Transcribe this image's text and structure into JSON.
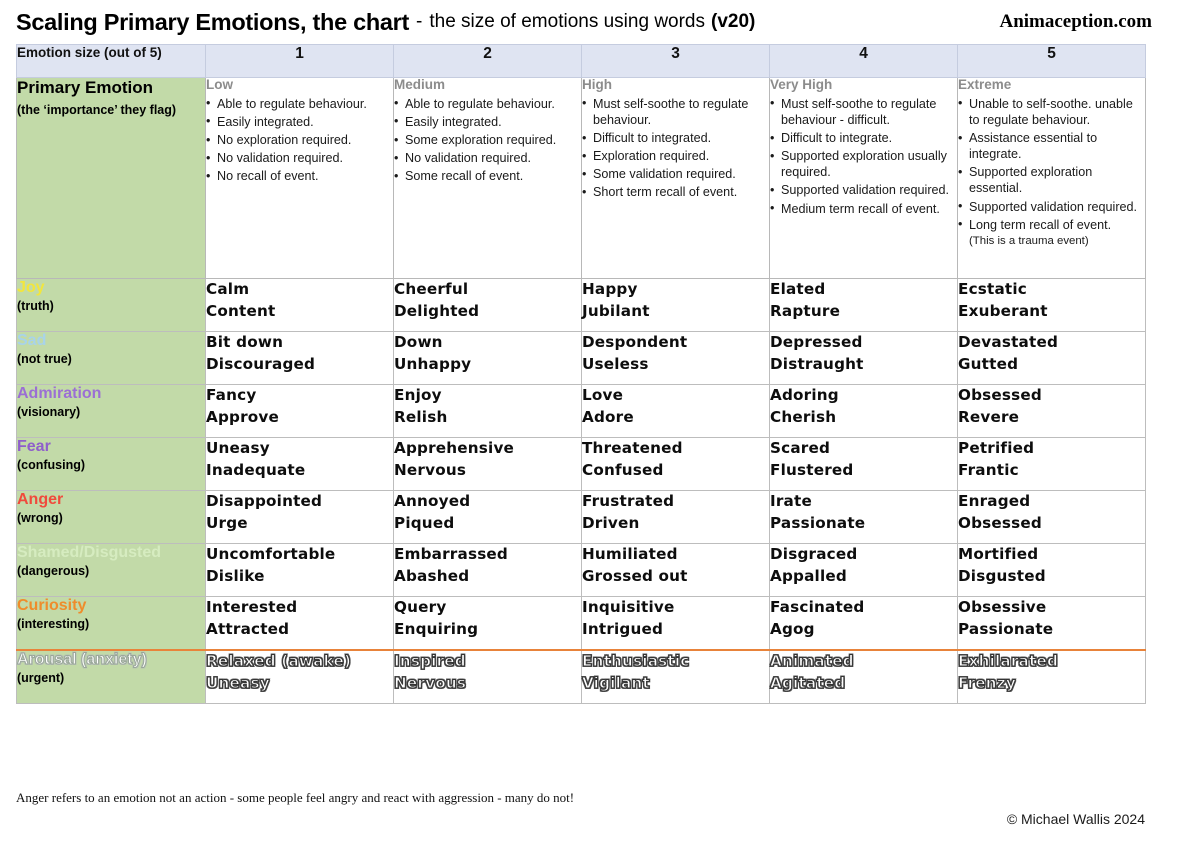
{
  "title": {
    "main": "Scaling Primary Emotions, the chart",
    "separator": "-",
    "subtitle": "the size of emotions using words",
    "version": "(v20)",
    "brand": "Animaception.com"
  },
  "header": {
    "label": "Emotion size (out of 5)",
    "levels": [
      "1",
      "2",
      "3",
      "4",
      "5"
    ]
  },
  "primary": {
    "title": "Primary Emotion",
    "subtitle": "(the ‘importance’ they flag)"
  },
  "descriptors": [
    {
      "heading": "Low",
      "bullets": [
        "Able to regulate behaviour.",
        "Easily integrated.",
        "No exploration required.",
        "No validation required.",
        "No recall of event."
      ],
      "note": ""
    },
    {
      "heading": "Medium",
      "bullets": [
        "Able to regulate behaviour.",
        "Easily integrated.",
        "Some exploration required.",
        "No validation required.",
        "Some recall of event."
      ],
      "note": ""
    },
    {
      "heading": "High",
      "bullets": [
        "Must self-soothe to regulate behaviour.",
        "Difficult to integrated.",
        "Exploration required.",
        "Some validation required.",
        "Short term recall of event."
      ],
      "note": ""
    },
    {
      "heading": "Very High",
      "bullets": [
        "Must self-soothe to regulate behaviour - difficult.",
        "Difficult to integrate.",
        "Supported exploration usually required.",
        "Supported validation required.",
        "Medium term recall of event."
      ],
      "note": ""
    },
    {
      "heading": "Extreme",
      "bullets": [
        "Unable to self-soothe. unable to regulate behaviour.",
        "Assistance essential to integrate.",
        "Supported exploration essential.",
        "Supported validation required.",
        "Long term recall of event."
      ],
      "note": "(This is a trauma event)"
    }
  ],
  "rows": [
    {
      "name": "Joy",
      "flag": "(truth)",
      "color": "#f2e63c",
      "outline": false,
      "cells": [
        [
          "Calm",
          "Content"
        ],
        [
          "Cheerful",
          "Delighted"
        ],
        [
          "Happy",
          "Jubilant"
        ],
        [
          "Elated",
          "Rapture"
        ],
        [
          "Ecstatic",
          "Exuberant"
        ]
      ]
    },
    {
      "name": "Sad",
      "flag": "(not true)",
      "color": "#a8d3ea",
      "outline": false,
      "cells": [
        [
          "Bit down",
          "Discouraged"
        ],
        [
          "Down",
          "Unhappy"
        ],
        [
          "Despondent",
          "Useless"
        ],
        [
          "Depressed",
          "Distraught"
        ],
        [
          "Devastated",
          "Gutted"
        ]
      ]
    },
    {
      "name": "Admiration",
      "flag": "(visionary)",
      "color": "#9b6fd4",
      "outline": false,
      "cells": [
        [
          "Fancy",
          "Approve"
        ],
        [
          "Enjoy",
          "Relish"
        ],
        [
          "Love",
          "Adore"
        ],
        [
          "Adoring",
          "Cherish"
        ],
        [
          "Obsessed",
          "Revere"
        ]
      ]
    },
    {
      "name": "Fear",
      "flag": "(confusing)",
      "color": "#8f5fcb",
      "outline": false,
      "cells": [
        [
          "Uneasy",
          "Inadequate"
        ],
        [
          "Apprehensive",
          "Nervous"
        ],
        [
          "Threatened",
          "Confused"
        ],
        [
          "Scared",
          "Flustered"
        ],
        [
          "Petrified",
          "Frantic"
        ]
      ]
    },
    {
      "name": "Anger",
      "flag": "(wrong)",
      "color": "#f04a3c",
      "outline": false,
      "cells": [
        [
          "Disappointed",
          "Urge"
        ],
        [
          "Annoyed",
          "Piqued"
        ],
        [
          "Frustrated",
          "Driven"
        ],
        [
          "Irate",
          "Passionate"
        ],
        [
          "Enraged",
          "Obsessed"
        ]
      ]
    },
    {
      "name": "Shamed/Disgusted",
      "flag": "(dangerous)",
      "color": "#d6ecc0",
      "outline": false,
      "cells": [
        [
          "Uncomfortable",
          "Dislike"
        ],
        [
          "Embarrassed",
          "Abashed"
        ],
        [
          "Humiliated",
          "Grossed out"
        ],
        [
          "Disgraced",
          "Appalled"
        ],
        [
          "Mortified",
          "Disgusted"
        ]
      ]
    },
    {
      "name": "Curiosity",
      "flag": "(interesting)",
      "color": "#ef8c2b",
      "outline": false,
      "cells": [
        [
          "Interested",
          "Attracted"
        ],
        [
          "Query",
          "Enquiring"
        ],
        [
          "Inquisitive",
          "Intrigued"
        ],
        [
          "Fascinated",
          "Agog"
        ],
        [
          "Obsessive",
          "Passionate"
        ]
      ]
    },
    {
      "name": "Arousal (anxiety)",
      "flag": "(urgent)",
      "color": "#ffffff",
      "outline": true,
      "cells": [
        [
          "Relaxed  (awake)",
          "Uneasy"
        ],
        [
          "Inspired",
          "Nervous"
        ],
        [
          "Enthusiastic",
          "Vigilant"
        ],
        [
          "Animated",
          "Agitated"
        ],
        [
          "Exhilarated",
          "Frenzy"
        ]
      ]
    }
  ],
  "footnotes": {
    "note": "Anger refers to an emotion not an action - some people feel angry and react with aggression - many do not!",
    "copyright": "© Michael Wallis 2024"
  },
  "colors": {
    "header_blue": "#dfe4f2",
    "label_green": "#c2daa8",
    "divider_orange": "#e8833a"
  }
}
